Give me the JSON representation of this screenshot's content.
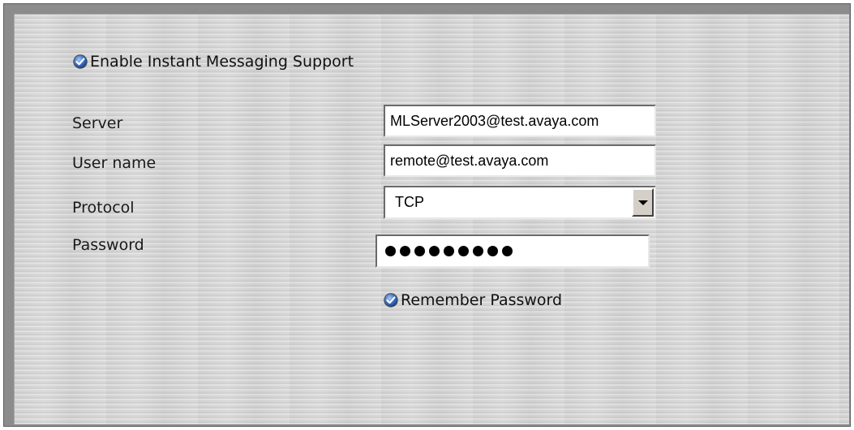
{
  "options": {
    "enable_im_label": "Enable Instant Messaging Support",
    "enable_im_checked": true,
    "remember_password_label": "Remember Password",
    "remember_password_checked": true
  },
  "form": {
    "server_label": "Server",
    "server_value": "MLServer2003@test.avaya.com",
    "username_label": "User name",
    "username_value": "remote@test.avaya.com",
    "protocol_label": "Protocol",
    "protocol_value": "TCP",
    "password_label": "Password",
    "password_masked_length": 9
  },
  "icons": {
    "checkbox": "check-circle-icon",
    "dropdown": "chevron-down-icon"
  },
  "colors": {
    "panel_background": "#d8d8d8",
    "check_accent": "#2a5db0"
  }
}
